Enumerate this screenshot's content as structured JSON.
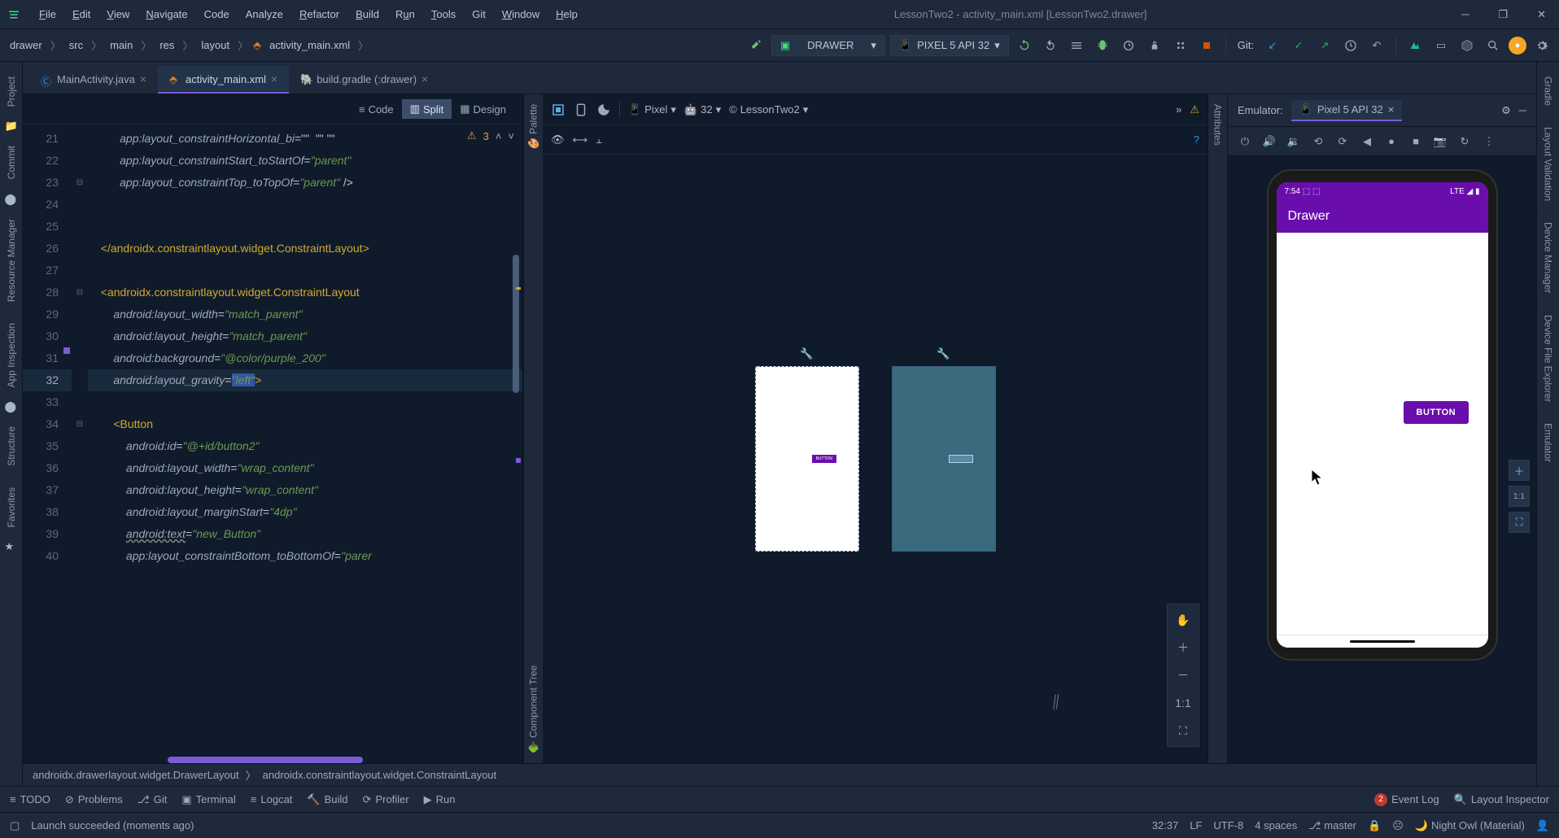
{
  "window": {
    "title": "LessonTwo2 - activity_main.xml [LessonTwo2.drawer]"
  },
  "menu": {
    "file": "File",
    "edit": "Edit",
    "view": "View",
    "navigate": "Navigate",
    "code": "Code",
    "analyze": "Analyze",
    "refactor": "Refactor",
    "build": "Build",
    "run": "Run",
    "tools": "Tools",
    "git": "Git",
    "window": "Window",
    "help": "Help"
  },
  "nav": {
    "crumb1": "drawer",
    "crumb2": "src",
    "crumb3": "main",
    "crumb4": "res",
    "crumb5": "layout",
    "crumb6": "activity_main.xml",
    "run_config": "DRAWER",
    "device": "PIXEL 5 API 32",
    "git": "Git:"
  },
  "left_tabs": {
    "project": "Project",
    "commit": "Commit",
    "resman": "Resource Manager",
    "appinspect": "App Inspection",
    "structure": "Structure",
    "favorites": "Favorites"
  },
  "right_tabs": {
    "gradle": "Gradle",
    "layout_validation": "Layout Validation",
    "device_manager": "Device Manager",
    "device_file": "Device File Explorer",
    "emulator": "Emulator"
  },
  "editor_tabs": {
    "t1": "MainActivity.java",
    "t2": "activity_main.xml",
    "t3": "build.gradle (:drawer)"
  },
  "view_modes": {
    "code": "Code",
    "split": "Split",
    "design": "Design"
  },
  "code": {
    "warn": {
      "count": "3"
    },
    "l21": {
      "attr": "app:layout_constraintHorizontal_bi",
      "rest": "=\"\"  \"\" \"\""
    },
    "l22": {
      "attr": "app:layout_constraintStart_toStartOf",
      "val": "\"parent\""
    },
    "l23": {
      "attr": "app:layout_constraintTop_toTopOf",
      "val": "\"parent\"",
      "end": " />"
    },
    "l26": {
      "tag": "</androidx.constraintlayout.widget.ConstraintLayout>"
    },
    "l28": {
      "tag": "<androidx.constraintlayout.widget.ConstraintLayout"
    },
    "l29": {
      "attr": "android:layout_width",
      "val": "\"match_parent\""
    },
    "l30": {
      "attr": "android:layout_height",
      "val": "\"match_parent\""
    },
    "l31": {
      "attr": "android:background",
      "val": "\"@color/purple_200\""
    },
    "l32": {
      "attr": "android:layout_gravity",
      "val": "\"left\"",
      "end": ">"
    },
    "l34": {
      "tag": "<Button"
    },
    "l35": {
      "attr": "android:id",
      "val": "\"@+id/button2\""
    },
    "l36": {
      "attr": "android:layout_width",
      "val": "\"wrap_content\""
    },
    "l37": {
      "attr": "android:layout_height",
      "val": "\"wrap_content\""
    },
    "l38": {
      "attr": "android:layout_marginStart",
      "val": "\"4dp\""
    },
    "l39": {
      "attr": "android:text",
      "val": "\"new_Button\""
    },
    "l40": {
      "attr": "app:layout_constraintBottom_toBottomOf",
      "val": "\"parer"
    },
    "line_nums": [
      "21",
      "22",
      "23",
      "24",
      "25",
      "26",
      "27",
      "28",
      "29",
      "30",
      "31",
      "32",
      "33",
      "34",
      "35",
      "36",
      "37",
      "38",
      "39",
      "40"
    ]
  },
  "editor_bread": {
    "b1": "androidx.drawerlayout.widget.DrawerLayout",
    "b2": "androidx.constraintlayout.widget.ConstraintLayout"
  },
  "design": {
    "palette": "Palette",
    "comptree": "Component Tree",
    "attributes": "Attributes",
    "device": "Pixel",
    "api": "32",
    "theme": "LessonTwo2",
    "btn_text": "BUTTON",
    "zoom_11": "1:1"
  },
  "emulator": {
    "label": "Emulator:",
    "device_name": "Pixel 5 API 32",
    "time": "7:54",
    "network": "LTE",
    "app_title": "Drawer",
    "button_text": "BUTTON"
  },
  "bottom": {
    "todo": "TODO",
    "problems": "Problems",
    "git": "Git",
    "terminal": "Terminal",
    "logcat": "Logcat",
    "build": "Build",
    "profiler": "Profiler",
    "run": "Run",
    "event_log": "Event Log",
    "event_count": "2",
    "layout_inspector": "Layout Inspector"
  },
  "status": {
    "msg": "Launch succeeded (moments ago)",
    "pos": "32:37",
    "le": "LF",
    "enc": "UTF-8",
    "indent": "4 spaces",
    "branch": "master",
    "theme": "Night Owl (Material)"
  }
}
